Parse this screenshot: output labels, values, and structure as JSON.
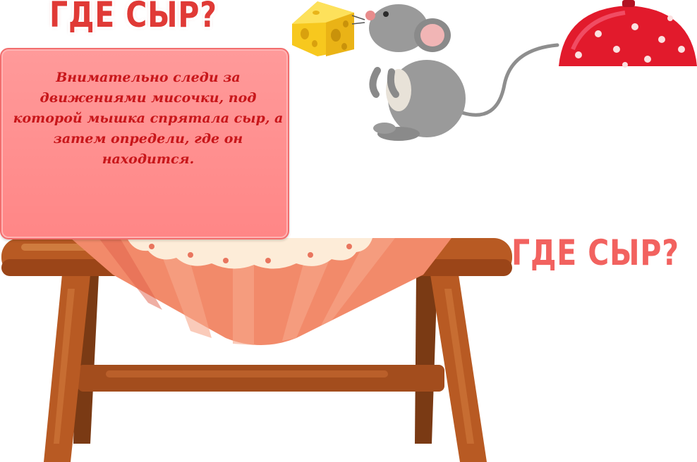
{
  "title_top": "ГДЕ СЫР?",
  "instruction": "Внимательно следи за движениями мисочки, под которой мышка спрятала сыр, а затем определи, где он находится.",
  "title_right": "ГДЕ СЫР?",
  "colors": {
    "title": "#e03a36",
    "card": "#ff8a8a",
    "card_text": "#c8161a",
    "lid": "#e21a2c",
    "table_wood": "#b85a23",
    "cheese": "#f7c81e",
    "mouse": "#9a9a9a"
  }
}
